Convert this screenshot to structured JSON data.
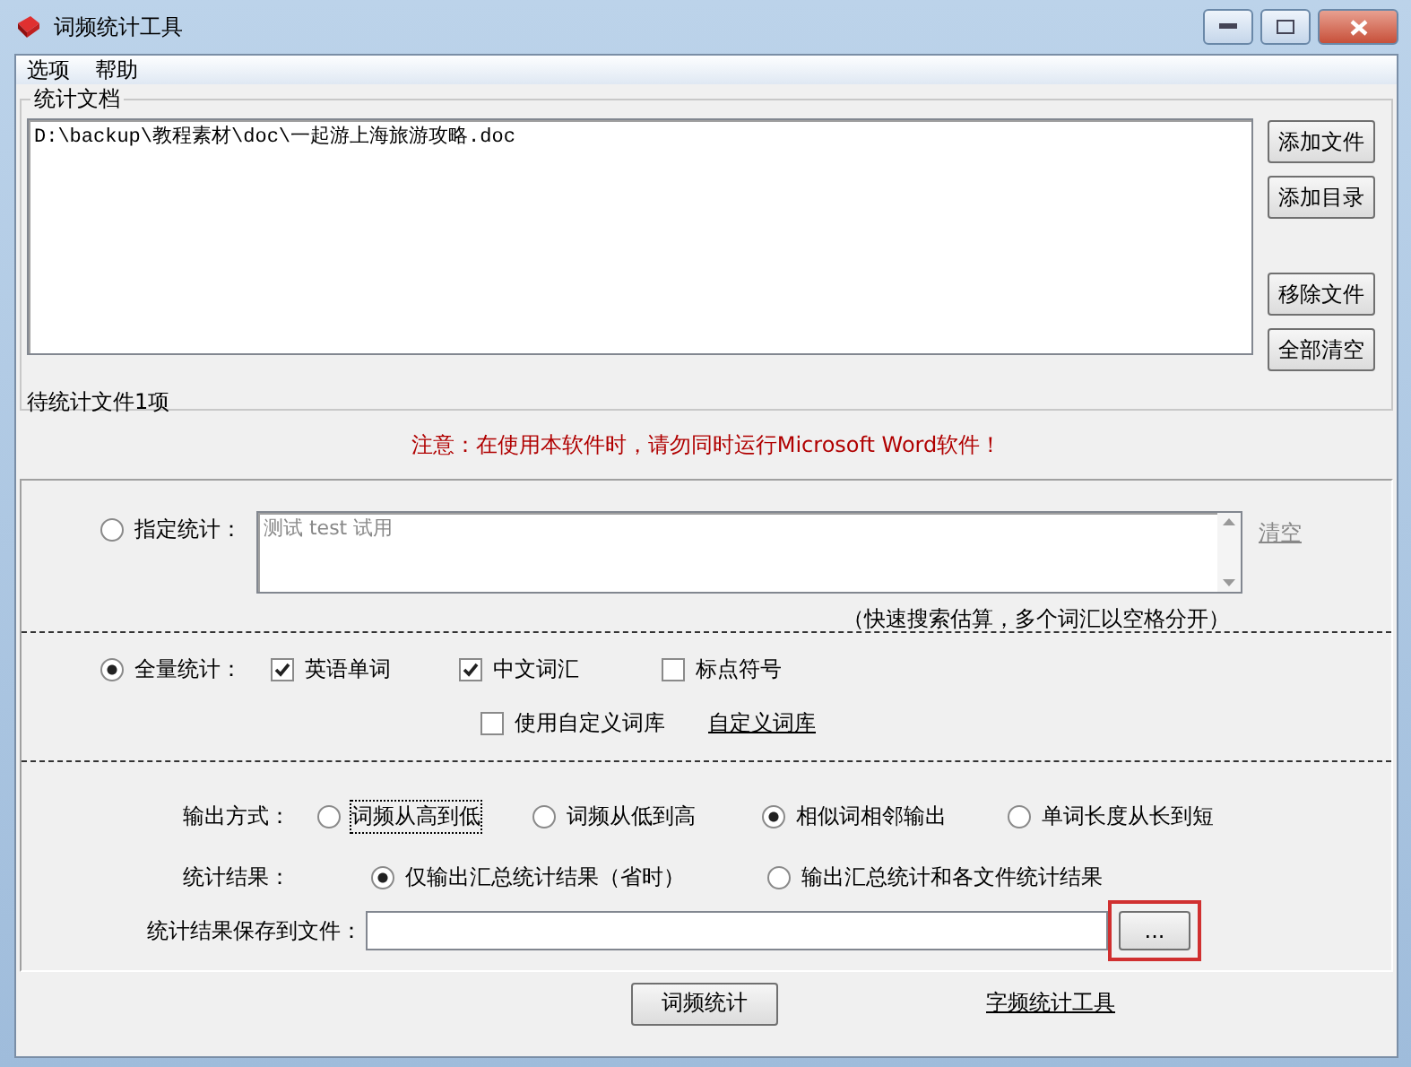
{
  "window": {
    "title": "词频统计工具"
  },
  "menu": [
    "选项",
    "帮助"
  ],
  "documents": {
    "label": "统计文档",
    "files": [
      "D:\\backup\\教程素材\\doc\\一起游上海旅游攻略.doc"
    ],
    "buttons": [
      "添加文件",
      "添加目录",
      "移除文件",
      "全部清空"
    ],
    "count": "待统计文件1项"
  },
  "notice": "注意：在使用本软件时，请勿同时运行Microsoft Word软件！",
  "specified": {
    "label": "指定统计：",
    "selected": false,
    "disabled": true,
    "value": "测试 test 试用",
    "clear": "清空",
    "hint": "（快速搜索估算，多个词汇以空格分开）"
  },
  "full": {
    "label": "全量统计：",
    "selected": true,
    "options": [
      {
        "label": "英语单词",
        "checked": true
      },
      {
        "label": "中文词汇",
        "checked": true
      },
      {
        "label": "标点符号",
        "checked": false
      }
    ],
    "custom": {
      "label": "使用自定义词库",
      "checked": false
    },
    "custom_link": "自定义词库"
  },
  "output_mode": {
    "label": "输出方式：",
    "options": [
      {
        "label": "词频从高到低",
        "selected": false,
        "focused": true
      },
      {
        "label": "词频从低到高",
        "selected": false,
        "focused": false
      },
      {
        "label": "相似词相邻输出",
        "selected": true,
        "focused": false
      },
      {
        "label": "单词长度从长到短",
        "selected": false,
        "focused": false
      }
    ]
  },
  "result": {
    "label": "统计结果：",
    "options": [
      {
        "label": "仅输出汇总统计结果（省时）",
        "selected": true
      },
      {
        "label": "输出汇总统计和各文件统计结果",
        "selected": false
      }
    ]
  },
  "save": {
    "label": "统计结果保存到文件：",
    "browse": "...",
    "highlighted": true
  },
  "footer": {
    "run": "词频统计",
    "link": "字频统计工具"
  }
}
